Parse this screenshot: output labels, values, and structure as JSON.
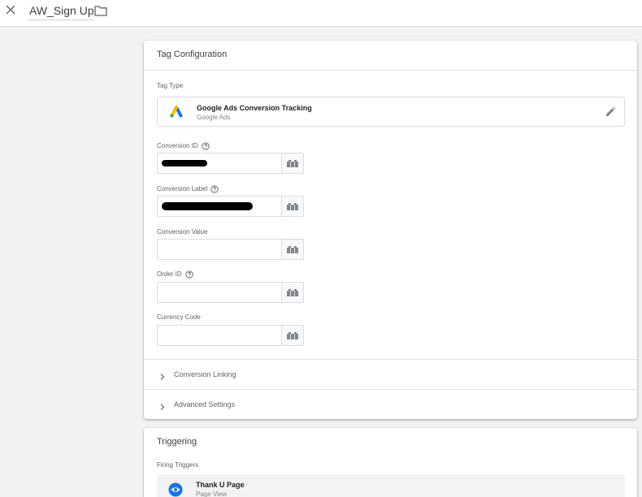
{
  "header": {
    "title": "AW_Sign Up"
  },
  "tag_configuration": {
    "title": "Tag Configuration",
    "tag_type_label": "Tag Type",
    "tag_type": {
      "name": "Google Ads Conversion Tracking",
      "subtitle": "Google Ads"
    },
    "fields": [
      {
        "label": "Conversion ID",
        "value": "",
        "has_help": true,
        "redacted": true
      },
      {
        "label": "Conversion Label",
        "value": "",
        "has_help": true,
        "redacted": true
      },
      {
        "label": "Conversion Value",
        "value": "",
        "has_help": false,
        "redacted": false
      },
      {
        "label": "Order ID",
        "value": "",
        "has_help": true,
        "redacted": false
      },
      {
        "label": "Currency Code",
        "value": "",
        "has_help": false,
        "redacted": false
      }
    ],
    "sections": [
      {
        "label": "Conversion Linking"
      },
      {
        "label": "Advanced Settings"
      }
    ]
  },
  "triggering": {
    "title": "Triggering",
    "firing_label": "Firing Triggers",
    "trigger": {
      "name": "Thank U Page",
      "subtitle": "Page View"
    }
  },
  "colors": {
    "accent_blue": "#1a73e8",
    "ads_yellow": "#fbbc04",
    "ads_green": "#34a853"
  }
}
